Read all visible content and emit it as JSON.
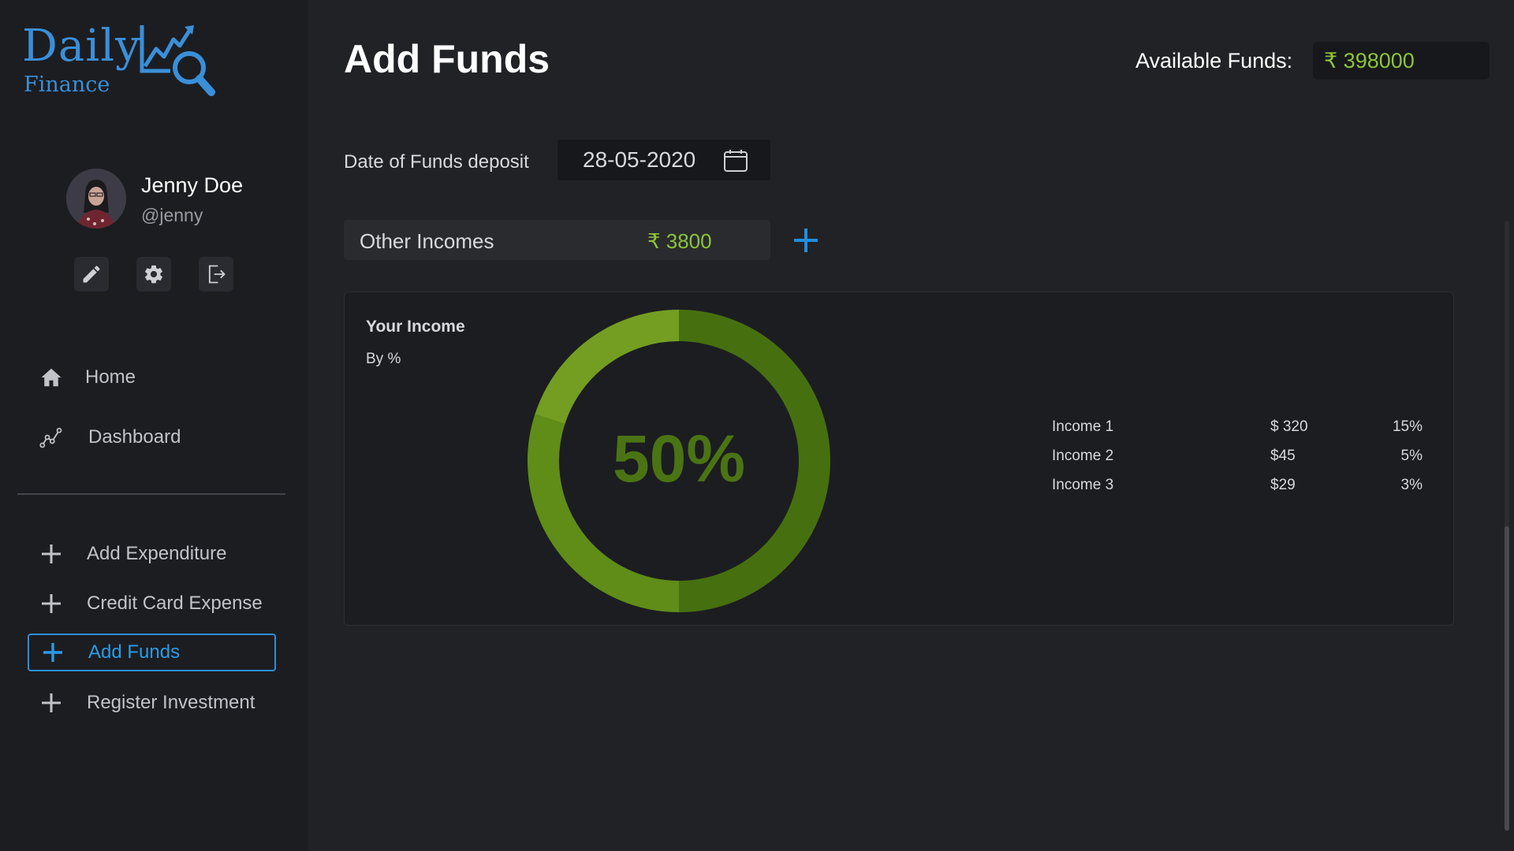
{
  "brand": {
    "name": "Daily",
    "sub": "Finance",
    "accent": "#3a8fd8"
  },
  "user": {
    "name": "Jenny Doe",
    "handle": "@jenny"
  },
  "profile_actions": [
    "edit-icon",
    "gear-icon",
    "logout-icon"
  ],
  "nav": {
    "home": "Home",
    "dashboard": "Dashboard"
  },
  "actions": {
    "add_expenditure": "Add Expenditure",
    "credit_card": "Credit Card Expense",
    "add_funds": "Add Funds",
    "register_investment": "Register Investment"
  },
  "header": {
    "title": "Add Funds",
    "funds_label": "Available Funds:",
    "funds_value": "₹ 398000"
  },
  "form": {
    "date_label": "Date of Funds deposit",
    "date_value": "28-05-2020",
    "other_label": "Other Incomes",
    "other_value": "₹ 3800"
  },
  "card": {
    "title": "Your Income",
    "subtitle": "By %"
  },
  "chart_data": {
    "type": "pie",
    "title": "Your Income",
    "subtitle": "By %",
    "center_label": "50%",
    "percent": 50,
    "colors": {
      "primary": "#46700f",
      "secondary": "#5f8d18",
      "tertiary": "#739e22"
    },
    "legend": [
      {
        "name": "Income 1",
        "value": "$ 320",
        "percent": "15%"
      },
      {
        "name": "Income 2",
        "value": "$45",
        "percent": "5%"
      },
      {
        "name": "Income 3",
        "value": "$29",
        "percent": "3%"
      }
    ]
  },
  "colors": {
    "positive": "#8cc43a",
    "active": "#2b8fd6"
  }
}
